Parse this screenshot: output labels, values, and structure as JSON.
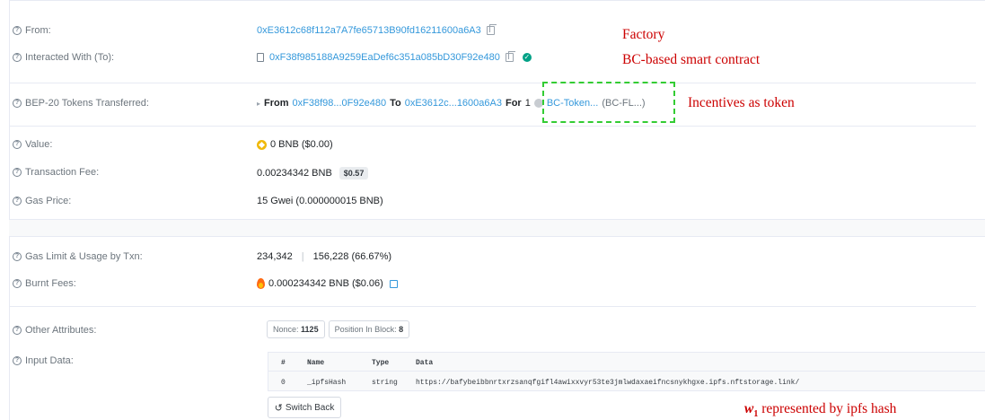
{
  "rows": {
    "from": {
      "label": "From:",
      "address": "0xE3612c68f112a7A7fe65713B90fd16211600a6A3"
    },
    "interacted": {
      "label": "Interacted With (To):",
      "address": "0xF38f985188A9259EaDef6c351a085bD30F92e480"
    },
    "tokens": {
      "label": "BEP-20 Tokens Transferred:",
      "from_word": "From",
      "from_addr": "0xF38f98...0F92e480",
      "to_word": "To",
      "to_addr": "0xE3612c...1600a6A3",
      "for_word": "For",
      "amount": "1",
      "token_name": "BC-Token...",
      "token_symbol": "(BC-FL...)"
    },
    "value": {
      "label": "Value:",
      "text": "0 BNB ($0.00)"
    },
    "fee": {
      "label": "Transaction Fee:",
      "text": "0.00234342 BNB",
      "badge": "$0.57"
    },
    "gas_price": {
      "label": "Gas Price:",
      "text": "15 Gwei (0.000000015 BNB)"
    },
    "gas_limit": {
      "label": "Gas Limit & Usage by Txn:",
      "limit": "234,342",
      "divider": "|",
      "usage": "156,228 (66.67%)"
    },
    "burnt": {
      "label": "Burnt Fees:",
      "text": "0.000234342 BNB ($0.06)"
    },
    "other": {
      "label": "Other Attributes:",
      "nonce_label": "Nonce:",
      "nonce": "1125",
      "position_label": "Position In Block:",
      "position": "8"
    },
    "input": {
      "label": "Input Data:",
      "headers": [
        "#",
        "Name",
        "Type",
        "Data"
      ],
      "row": [
        "0",
        "_ipfsHash",
        "string",
        "https://bafybeibbnrtxrzsanqfgifl4awixxvyr53te3jmlwdaxaeifncsnykhgxe.ipfs.nftstorage.link/"
      ],
      "switch_label": "Switch Back"
    }
  },
  "annotations": {
    "factory": "Factory",
    "contract": "BC-based smart contract",
    "incentives": "Incentives as token",
    "w1_symbol": "w",
    "w1_sub": "1",
    "w1_text": "represented by ipfs hash"
  },
  "colors": {
    "link": "#3498db",
    "annotation": "#cc0000",
    "dashbox": "#33cc33"
  },
  "icons": [
    "question-icon",
    "copy-icon",
    "verified-check-icon",
    "contract-doc-icon",
    "bnb-coin-icon",
    "fire-icon",
    "external-link-icon",
    "token-icon",
    "switch-back-icon"
  ]
}
